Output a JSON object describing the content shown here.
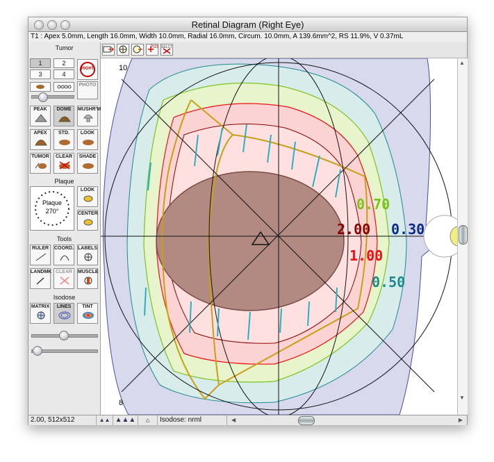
{
  "window": {
    "title": "Retinal Diagram (Right Eye)",
    "info": "T1 : Apex 5.0mm, Length 16.0mm, Width 10.0mm, Radial 16.0mm, Circum. 10.0mm, A 139.6mm^2, RS 11.9%, V 0.37mL"
  },
  "toolbar": {
    "buttons": [
      "arrow-tool-icon",
      "target-tool-icon",
      "eye-tool-icon",
      "poi-tool-icon",
      "select-tool-icon"
    ],
    "poi_label": "POI",
    "select_label": "SELCT"
  },
  "palette": {
    "tumor_heading": "Tumor",
    "tumor_numbers": [
      "1",
      "2",
      "3",
      "4"
    ],
    "right_badge": "RIGHT",
    "photo_label": "PHOTO",
    "shape_buttons": [
      {
        "label": "PEAK",
        "icon": "peak-icon"
      },
      {
        "label": "DOME",
        "icon": "dome-icon"
      },
      {
        "label": "MUSHR'M",
        "icon": "mushroom-icon"
      },
      {
        "label": "APEX",
        "icon": "apex-icon"
      },
      {
        "label": "STD.",
        "icon": "standard-icon"
      },
      {
        "label": "LOOK",
        "icon": "look-icon"
      },
      {
        "label": "TUMOR",
        "icon": "tumor-icon"
      },
      {
        "label": "CLEAR",
        "icon": "clear-icon"
      },
      {
        "label": "SHADE",
        "icon": "shade-icon"
      }
    ],
    "plaque_heading": "Plaque",
    "plaque_dial_label": "Plaque",
    "plaque_angle": "270°",
    "plaque_look": "LOOK",
    "plaque_center": "CENTER",
    "tools_heading": "Tools",
    "tool_buttons": [
      {
        "label": "RULER",
        "icon": "ruler-icon"
      },
      {
        "label": "COORD.",
        "icon": "coordinate-icon"
      },
      {
        "label": "LABELS",
        "icon": "labels-icon"
      },
      {
        "label": "LANDMK",
        "icon": "landmark-icon"
      },
      {
        "label": "CLEAR",
        "icon": "clear-landmark-icon"
      },
      {
        "label": "MUSCLE",
        "icon": "muscle-icon"
      }
    ],
    "isodose_heading": "Isodose",
    "isodose_buttons": [
      {
        "label": "MATRIX",
        "icon": "matrix-icon"
      },
      {
        "label": "LINES",
        "icon": "lines-icon"
      },
      {
        "label": "TINT",
        "icon": "tint-icon"
      }
    ]
  },
  "canvas": {
    "axis_top_label": "10",
    "axis_bottom_label": "8",
    "isodose_labels": [
      {
        "text": "0.70",
        "color": "#7ac41c"
      },
      {
        "text": "2.00",
        "color": "#8b0000"
      },
      {
        "text": "0.30",
        "color": "#0a2a8a"
      },
      {
        "text": "1.00",
        "color": "#ee1111"
      },
      {
        "text": "0.50",
        "color": "#1c8a8a"
      }
    ]
  },
  "status": {
    "zoom_info": "2.00, 512x512",
    "isodose_mode": "Isodose: nrml"
  },
  "colors": {
    "iso_030_fill": "#d9d9ee",
    "iso_050_fill": "#d8ecec",
    "iso_070_fill": "#e8f4cc",
    "iso_100_fill": "#fcd3d3",
    "iso_200_fill": "#ffe0e0",
    "tumor_fill": "#b38a82",
    "plaque_gold": "#c8a016"
  }
}
